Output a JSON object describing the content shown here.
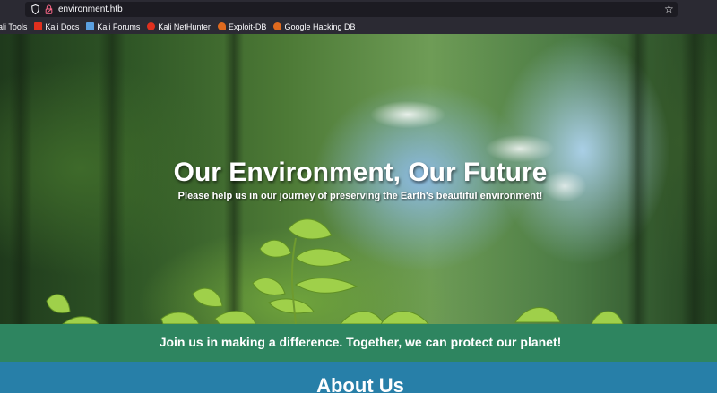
{
  "browser": {
    "url": "environment.htb",
    "bookmarks": [
      {
        "label": "ali Tools",
        "color": "#367bf0"
      },
      {
        "label": "Kali Docs",
        "color": "#e0301e"
      },
      {
        "label": "Kali Forums",
        "color": "#5ba0e0"
      },
      {
        "label": "Kali NetHunter",
        "color": "#e0301e"
      },
      {
        "label": "Exploit-DB",
        "color": "#e06a1e"
      },
      {
        "label": "Google Hacking DB",
        "color": "#e06a1e"
      }
    ]
  },
  "hero": {
    "title": "Our Environment, Our Future",
    "subtitle": "Please help us in our journey of preserving the Earth's beautiful environment!"
  },
  "banner": {
    "text": "Join us in making a difference. Together, we can protect our planet!",
    "color": "#2e8560"
  },
  "about": {
    "title": "About Us",
    "color": "#277fa8"
  }
}
